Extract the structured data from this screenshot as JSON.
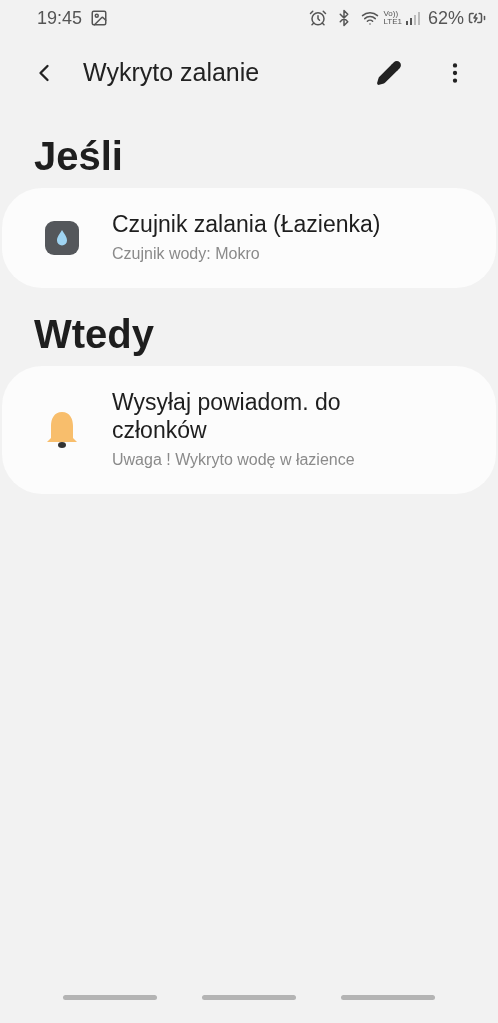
{
  "status_bar": {
    "time": "19:45",
    "volte": "Vo))",
    "lte": "LTE1",
    "battery": "62%"
  },
  "toolbar": {
    "title": "Wykryto zalanie"
  },
  "sections": [
    {
      "heading": "Jeśli",
      "cards": [
        {
          "kind": "sensor",
          "title": "Czujnik zalania (Łazienka)",
          "subtitle": "Czujnik wody: Mokro"
        }
      ]
    },
    {
      "heading": "Wtedy",
      "cards": [
        {
          "kind": "notification",
          "title": "Wysyłaj powiadom. do członków",
          "subtitle": "Uwaga ! Wykryto wodę w łazience"
        }
      ]
    }
  ]
}
